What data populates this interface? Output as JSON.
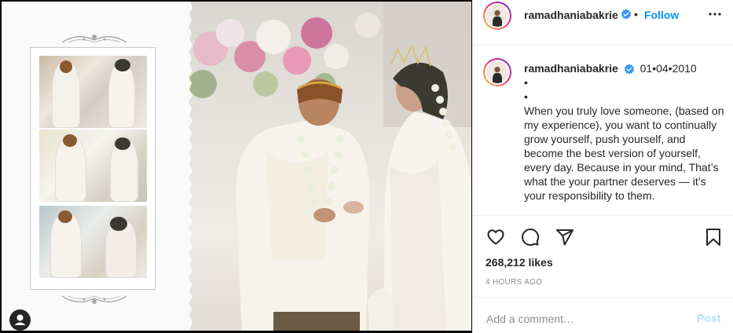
{
  "header": {
    "username": "ramadhaniabakrie",
    "separator": "•",
    "follow_label": "Follow",
    "verified_icon": "verified-badge-icon",
    "more_icon": "more-options-icon"
  },
  "caption": {
    "username": "ramadhaniabakrie",
    "date": "01•04•2010",
    "bullet1": "•",
    "bullet2": "•",
    "text": "When you truly love someone, (based on my experience), you want to continually grow yourself, push yourself, and become the best version of yourself, every day. Because in your mind, That’s what the your partner deserves — it’s your responsibility to them."
  },
  "actions": {
    "like_icon": "heart-icon",
    "comment_icon": "comment-icon",
    "share_icon": "share-icon",
    "save_icon": "bookmark-icon"
  },
  "likes_text": "268,212 likes",
  "time_text": "4 HOURS AGO",
  "comment": {
    "placeholder": "Add a comment…",
    "value": "",
    "post_label": "Post"
  },
  "colors": {
    "accent": "#0095f6",
    "post_disabled": "#b2dffc",
    "text": "#262626",
    "muted": "#8e8e8e"
  },
  "media": {
    "tag_icon": "user-tag-icon"
  }
}
